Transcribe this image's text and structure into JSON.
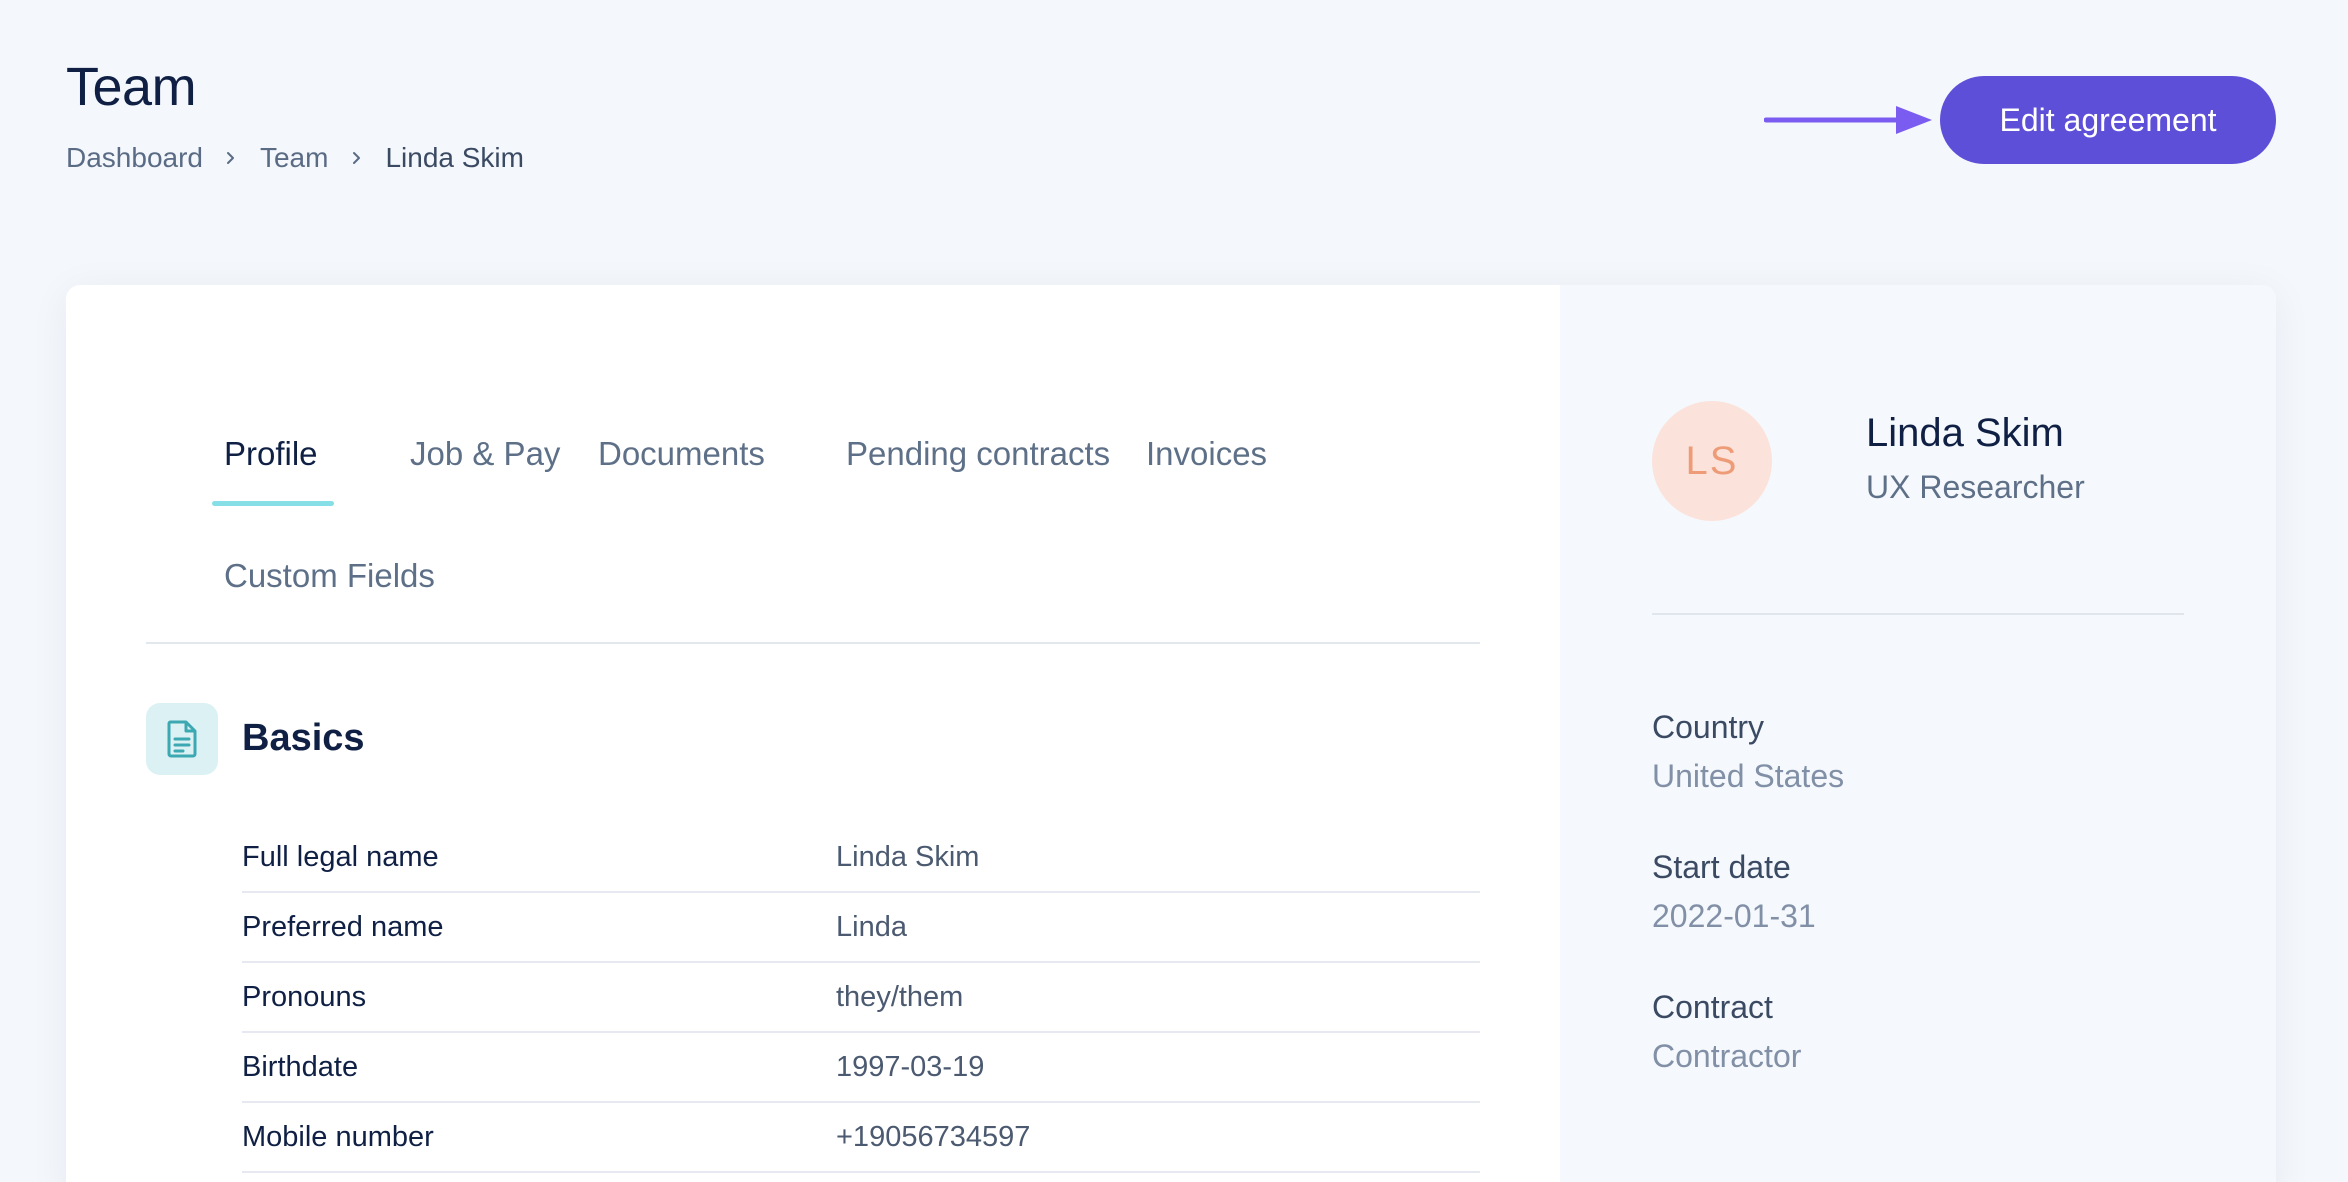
{
  "header": {
    "title": "Team",
    "breadcrumb": [
      "Dashboard",
      "Team",
      "Linda Skim"
    ],
    "edit_button": "Edit agreement"
  },
  "tabs": [
    {
      "label": "Profile",
      "active": true
    },
    {
      "label": "Job & Pay",
      "active": false
    },
    {
      "label": "Documents",
      "active": false
    },
    {
      "label": "Pending contracts",
      "active": false
    },
    {
      "label": "Invoices",
      "active": false
    },
    {
      "label": "Custom Fields",
      "active": false
    }
  ],
  "basics": {
    "title": "Basics",
    "icon": "document-icon",
    "fields": [
      {
        "label": "Full legal name",
        "value": "Linda Skim"
      },
      {
        "label": "Preferred name",
        "value": "Linda"
      },
      {
        "label": "Pronouns",
        "value": "they/them"
      },
      {
        "label": "Birthdate",
        "value": "1997-03-19"
      },
      {
        "label": "Mobile number",
        "value": "+19056734597"
      }
    ]
  },
  "profile": {
    "initials": "LS",
    "name": "Linda Skim",
    "role": "UX Researcher",
    "details": [
      {
        "label": "Country",
        "value": "United States"
      },
      {
        "label": "Start date",
        "value": "2022-01-31"
      },
      {
        "label": "Contract",
        "value": "Contractor"
      }
    ]
  },
  "colors": {
    "accent": "#5d4fd8",
    "annotation_arrow": "#7b5cf0",
    "tab_underline": "#86dfe6",
    "avatar_bg": "#fbe3db",
    "avatar_text": "#ee9b77"
  }
}
